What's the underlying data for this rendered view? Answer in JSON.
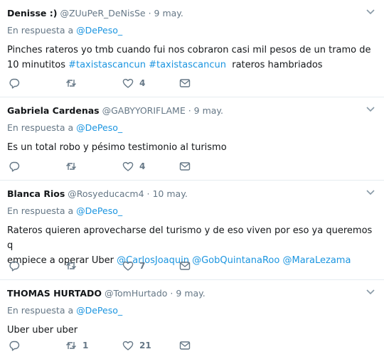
{
  "tweets": [
    {
      "name": "Denisse :)",
      "handle": "@ZUuPeR_DeNisSe",
      "dot": "·",
      "time": "9 may.",
      "reply_prefix": "En respuesta a",
      "reply_to": "@DePeso_",
      "text_line1": "Pinches rateros yo tmb cuando fui nos cobraron casi mil pesos de un tramo de",
      "text_line2_start": "10 minutitos ",
      "hashtag1": "#taxistascancun",
      "hashtag2": "#taxistascancun",
      "text_line2_end": "  rateros hambriados",
      "retweets": "",
      "likes": "4"
    },
    {
      "name": "Gabriela Cardenas",
      "handle": "@GABYYORIFLAME",
      "dot": "·",
      "time": "9 may.",
      "reply_prefix": "En respuesta a",
      "reply_to": "@DePeso_",
      "text": "Es un total robo y pésimo testimonio al turismo",
      "retweets": "",
      "likes": "4"
    },
    {
      "name": "Blanca Rios",
      "handle": "@Rosyeducacm4",
      "dot": "·",
      "time": "10 may.",
      "reply_prefix": "En respuesta a",
      "reply_to": "@DePeso_",
      "text_line1": "Rateros quieren aprovecharse del turismo y de eso viven por eso ya queremos q",
      "text_line2_start": "empiece a operar Uber ",
      "mention1": "@CarlosJoaquin",
      "mention2": "@GobQuintanaRoo",
      "mention3": "@MaraLezama",
      "retweets": "",
      "likes": "7"
    },
    {
      "name": "THOMAS HURTADO",
      "handle": "@TomHurtado",
      "dot": "·",
      "time": "9 may.",
      "reply_prefix": "En respuesta a",
      "reply_to": "@DePeso_",
      "text": "Uber uber uber",
      "retweets": "1",
      "likes": "21"
    }
  ],
  "colors": {
    "link": "#1b95e0",
    "secondary": "#657786",
    "text": "#14171a",
    "divider": "#e6ecf0"
  },
  "icons": [
    "reply-icon",
    "retweet-icon",
    "like-icon",
    "direct-message-icon",
    "caret-down-icon"
  ]
}
